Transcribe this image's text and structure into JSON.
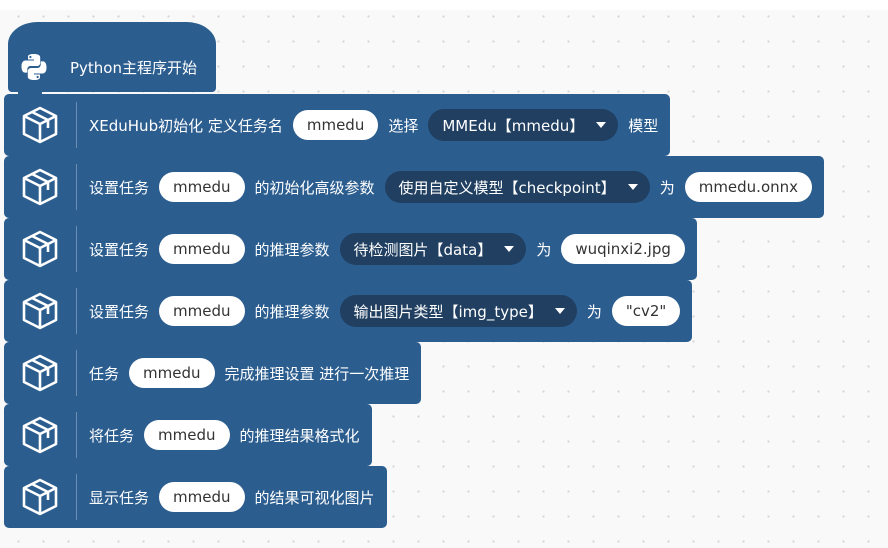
{
  "hat": {
    "label": "Python主程序开始"
  },
  "blocks": [
    {
      "parts": [
        {
          "kind": "text",
          "value": "XEduHub初始化 定义任务名"
        },
        {
          "kind": "pill",
          "value": "mmedu"
        },
        {
          "kind": "text",
          "value": "选择"
        },
        {
          "kind": "drop",
          "value": "MMEdu【mmedu】"
        },
        {
          "kind": "text",
          "value": "模型"
        }
      ]
    },
    {
      "parts": [
        {
          "kind": "text",
          "value": "设置任务"
        },
        {
          "kind": "pill",
          "value": "mmedu"
        },
        {
          "kind": "text",
          "value": "的初始化高级参数"
        },
        {
          "kind": "drop",
          "value": "使用自定义模型【checkpoint】"
        },
        {
          "kind": "text",
          "value": "为"
        },
        {
          "kind": "pill",
          "value": "mmedu.onnx"
        }
      ]
    },
    {
      "parts": [
        {
          "kind": "text",
          "value": "设置任务"
        },
        {
          "kind": "pill",
          "value": "mmedu"
        },
        {
          "kind": "text",
          "value": "的推理参数"
        },
        {
          "kind": "drop",
          "value": "待检测图片【data】"
        },
        {
          "kind": "text",
          "value": "为"
        },
        {
          "kind": "pill",
          "value": "wuqinxi2.jpg"
        }
      ]
    },
    {
      "parts": [
        {
          "kind": "text",
          "value": "设置任务"
        },
        {
          "kind": "pill",
          "value": "mmedu"
        },
        {
          "kind": "text",
          "value": "的推理参数"
        },
        {
          "kind": "drop",
          "value": "输出图片类型【img_type】"
        },
        {
          "kind": "text",
          "value": "为"
        },
        {
          "kind": "pill",
          "value": "\"cv2\""
        }
      ]
    },
    {
      "parts": [
        {
          "kind": "text",
          "value": "任务"
        },
        {
          "kind": "pill",
          "value": "mmedu"
        },
        {
          "kind": "text",
          "value": "完成推理设置 进行一次推理"
        }
      ]
    },
    {
      "parts": [
        {
          "kind": "text",
          "value": "将任务"
        },
        {
          "kind": "pill",
          "value": "mmedu"
        },
        {
          "kind": "text",
          "value": "的推理结果格式化"
        }
      ]
    },
    {
      "parts": [
        {
          "kind": "text",
          "value": "显示任务"
        },
        {
          "kind": "pill",
          "value": "mmedu"
        },
        {
          "kind": "text",
          "value": "的结果可视化图片"
        }
      ]
    }
  ]
}
